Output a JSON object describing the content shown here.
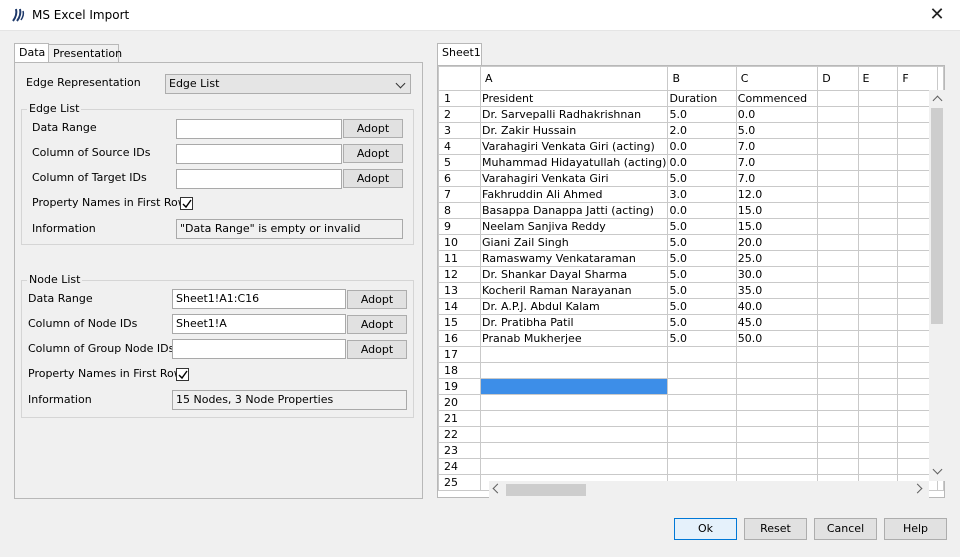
{
  "window": {
    "title": "MS Excel Import",
    "close_label": "✕"
  },
  "left_tabs": [
    {
      "label": "Data"
    },
    {
      "label": "Presentation"
    }
  ],
  "edge_representation": {
    "label": "Edge Representation",
    "value": "Edge List"
  },
  "edge_list": {
    "legend": "Edge List",
    "data_range_label": "Data Range",
    "data_range_value": "",
    "source_ids_label": "Column of Source IDs",
    "source_ids_value": "",
    "target_ids_label": "Column of Target IDs",
    "target_ids_value": "",
    "adopt_label": "Adopt",
    "names_first_row_label": "Property Names in First Row",
    "names_first_row_checked": true,
    "information_label": "Information",
    "information_value": "\"Data Range\" is empty or invalid"
  },
  "node_list": {
    "legend": "Node List",
    "data_range_label": "Data Range",
    "data_range_value": "Sheet1!A1:C16",
    "node_ids_label": "Column of Node IDs",
    "node_ids_value": "Sheet1!A",
    "group_ids_label": "Column of Group Node IDs",
    "group_ids_value": "",
    "adopt_label": "Adopt",
    "names_first_row_label": "Property Names in First Row",
    "names_first_row_checked": true,
    "information_label": "Information",
    "information_value": "15 Nodes, 3 Node Properties"
  },
  "sheet": {
    "tab_label": "Sheet1",
    "columns": [
      "A",
      "B",
      "C",
      "D",
      "E",
      "F"
    ],
    "row_numbers": [
      "1",
      "2",
      "3",
      "4",
      "5",
      "6",
      "7",
      "8",
      "9",
      "10",
      "11",
      "12",
      "13",
      "14",
      "15",
      "16",
      "17",
      "18",
      "19",
      "20",
      "21",
      "22",
      "23",
      "24",
      "25"
    ],
    "rows": [
      [
        "President",
        "Duration",
        "Commenced"
      ],
      [
        "Dr. Sarvepalli Radhakrishnan",
        "5.0",
        "0.0"
      ],
      [
        "Dr. Zakir Hussain",
        "2.0",
        "5.0"
      ],
      [
        "Varahagiri Venkata Giri (acting)",
        "0.0",
        "7.0"
      ],
      [
        "Muhammad Hidayatullah (acting)",
        "0.0",
        "7.0"
      ],
      [
        "Varahagiri Venkata Giri",
        "5.0",
        "7.0"
      ],
      [
        "Fakhruddin Ali Ahmed",
        "3.0",
        "12.0"
      ],
      [
        "Basappa Danappa Jatti (acting)",
        "0.0",
        "15.0"
      ],
      [
        "Neelam Sanjiva Reddy",
        "5.0",
        "15.0"
      ],
      [
        "Giani Zail Singh",
        "5.0",
        "20.0"
      ],
      [
        "Ramaswamy Venkataraman",
        "5.0",
        "25.0"
      ],
      [
        "Dr. Shankar Dayal Sharma",
        "5.0",
        "30.0"
      ],
      [
        "Kocheril Raman Narayanan",
        "5.0",
        "35.0"
      ],
      [
        "Dr. A.P.J. Abdul Kalam",
        "5.0",
        "40.0"
      ],
      [
        "Dr. Pratibha Patil",
        "5.0",
        "45.0"
      ],
      [
        "Pranab Mukherjee",
        "5.0",
        "50.0"
      ]
    ],
    "selected_row": "19",
    "selection_color": "#3d8ee8"
  },
  "buttons": {
    "ok": "Ok",
    "reset": "Reset",
    "cancel": "Cancel",
    "help": "Help"
  }
}
